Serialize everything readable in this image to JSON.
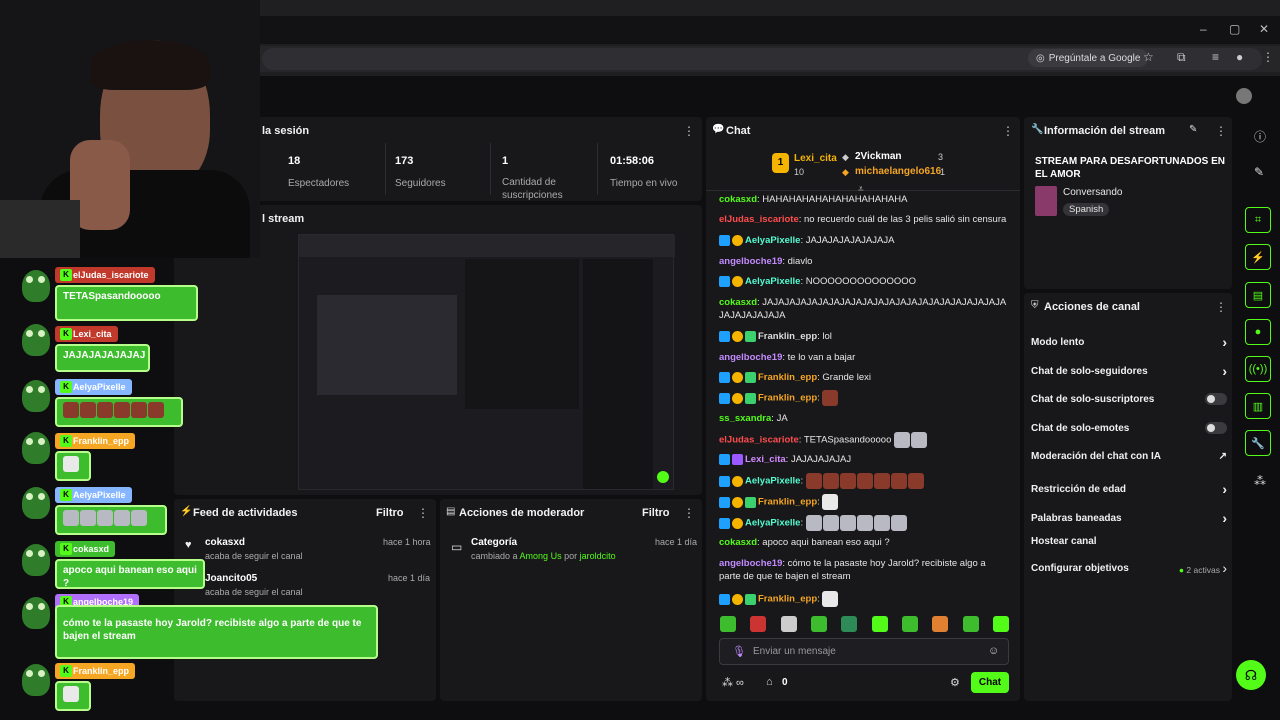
{
  "browser": {
    "google_btn": "Pregúntale a Google"
  },
  "session": {
    "title_partial": "la sesión",
    "stats": [
      {
        "value": "18",
        "label": "Espectadores"
      },
      {
        "value": "173",
        "label": "Seguidores"
      },
      {
        "value": "1",
        "label": "Cantidad de suscripciones"
      },
      {
        "value": "01:58:06",
        "label": "Tiempo en vivo"
      }
    ],
    "stream_preview_title": "l stream"
  },
  "feed": {
    "title": "Feed de actividades",
    "filter": "Filtro",
    "items": [
      {
        "user": "cokasxd",
        "action": "acaba de seguir el canal",
        "time": "hace 1 hora"
      },
      {
        "user": "Joancito05",
        "action": "acaba de seguir el canal",
        "time": "hace 1 día"
      }
    ]
  },
  "moderator": {
    "title": "Acciones de moderador",
    "filter": "Filtro",
    "item": {
      "title": "Categoría",
      "prefix": "cambiado a",
      "game": "Among Us",
      "by": "por",
      "user": "jaroldcito",
      "time": "hace 1 día"
    }
  },
  "chat": {
    "title": "Chat",
    "leaderboard": [
      {
        "rank": "1",
        "name": "Lexi_cita",
        "count": "10"
      },
      {
        "name": "2Vickman",
        "count": "3"
      },
      {
        "name": "michaelangelo616",
        "count": "1"
      }
    ],
    "messages": [
      {
        "user": "cokasxd",
        "text": ": HAHAHAHAHAHAHAHAHAHAHA"
      },
      {
        "user": "elJudas_iscariote",
        "text": ": no recuerdo cuál de las 3 pelis salió sin censura"
      },
      {
        "user": "AelyaPixelle",
        "text": ": JAJAJAJAJAJAJAJA"
      },
      {
        "user": "angelboche19",
        "text": ": diavlo"
      },
      {
        "user": "AelyaPixelle",
        "text": ": NOOOOOOOOOOOOOO"
      },
      {
        "user": "cokasxd",
        "text": ": JAJAJAJAJAJAJAJAJAJAJAJAJAJAJAJAJAJAJAJAJAJAJAJAJAJAJAJA"
      },
      {
        "user": "Franklin_epp",
        "text": ": lol"
      },
      {
        "user": "angelboche19",
        "text": ": te lo van a bajar"
      },
      {
        "user": "Franklin_epp",
        "text": ": Grande lexi"
      },
      {
        "user": "Franklin_epp",
        "text": ":"
      },
      {
        "user": "ss_sxandra",
        "text": ": JA"
      },
      {
        "user": "elJudas_iscariote",
        "text": ": TETASpasandooooo"
      },
      {
        "user": "Lexi_cita",
        "text": ": JAJAJAJAJAJ"
      },
      {
        "user": "AelyaPixelle",
        "text": ":"
      },
      {
        "user": "Franklin_epp",
        "text": ":"
      },
      {
        "user": "AelyaPixelle",
        "text": ":"
      },
      {
        "user": "cokasxd",
        "text": ": apoco aqui banean eso aqui ?"
      },
      {
        "user": "angelboche19",
        "text": ": cómo te la pasaste hoy Jarold? recibiste algo a parte de que te bajen el stream"
      },
      {
        "user": "Franklin_epp",
        "text": ":"
      }
    ],
    "input_placeholder": "Enviar un mensaje",
    "points": "0",
    "send": "Chat"
  },
  "info": {
    "title": "Información del stream",
    "stream_title": "STREAM PARA DESAFORTUNADOS EN EL AMOR",
    "category": "Conversando",
    "language": "Spanish"
  },
  "actions": {
    "title": "Acciones de canal",
    "items": [
      {
        "label": "Modo lento"
      },
      {
        "label": "Chat de solo-seguidores"
      },
      {
        "label": "Chat de solo-suscriptores"
      },
      {
        "label": "Chat de solo-emotes"
      },
      {
        "label": "Moderación del chat con IA"
      },
      {
        "label": "Restricción de edad"
      },
      {
        "label": "Palabras baneadas"
      },
      {
        "label": "Hostear canal"
      },
      {
        "label": "Configurar objetivos",
        "extra": "2 activas"
      }
    ]
  },
  "overlay": [
    {
      "user": "elJudas_iscariote",
      "text": "TETASpasandooooo"
    },
    {
      "user": "Lexi_cita",
      "text": "JAJAJAJAJAJAJ"
    },
    {
      "user": "AelyaPixelle",
      "text": ""
    },
    {
      "user": "Franklin_epp",
      "text": ""
    },
    {
      "user": "AelyaPixelle",
      "text": ""
    },
    {
      "user": "cokasxd",
      "text": "apoco aqui banean eso aqui ?"
    },
    {
      "user": "angelboche19",
      "text": "cómo te la pasaste hoy Jarold? recibiste algo a parte de que te bajen el stream"
    },
    {
      "user": "Franklin_epp",
      "text": ""
    }
  ],
  "colors": {
    "accent": "#53fc18",
    "panel": "#18181b",
    "bg": "#0e0e10"
  }
}
